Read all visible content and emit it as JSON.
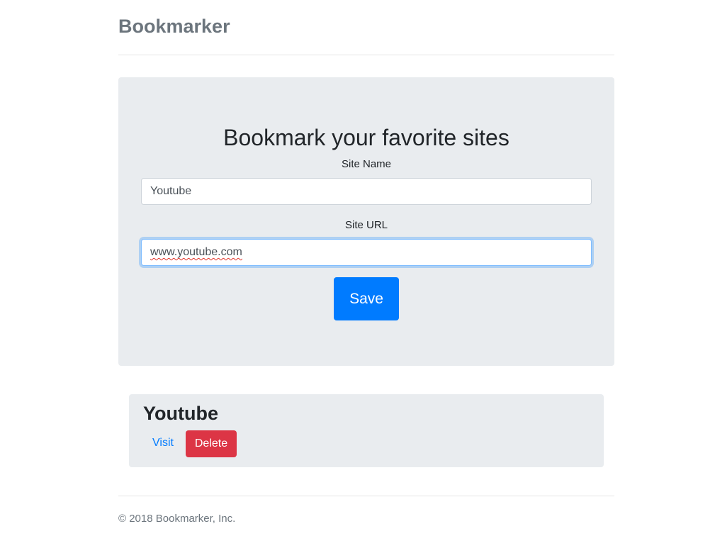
{
  "header": {
    "brand": "Bookmarker"
  },
  "form": {
    "heading": "Bookmark your favorite sites",
    "site_name_label": "Site Name",
    "site_name_value": "Youtube",
    "site_url_label": "Site URL",
    "site_url_value": "www.youtube.com",
    "save_label": "Save"
  },
  "bookmarks": [
    {
      "name": "Youtube",
      "visit_label": "Visit",
      "delete_label": "Delete"
    }
  ],
  "footer": {
    "text": "© 2018 Bookmarker, Inc."
  },
  "colors": {
    "primary": "#007bff",
    "danger": "#dc3545",
    "muted": "#6c757d",
    "panel": "#e9ecef"
  }
}
